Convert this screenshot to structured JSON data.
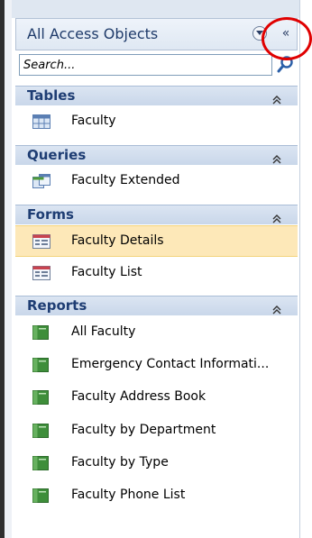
{
  "header": {
    "title": "All Access Objects",
    "shutter_label": "«"
  },
  "search": {
    "placeholder": "Search..."
  },
  "groups": {
    "tables": {
      "title": "Tables",
      "items": [
        {
          "label": "Faculty"
        }
      ]
    },
    "queries": {
      "title": "Queries",
      "items": [
        {
          "label": "Faculty Extended"
        }
      ]
    },
    "forms": {
      "title": "Forms",
      "items": [
        {
          "label": "Faculty Details"
        },
        {
          "label": "Faculty List"
        }
      ]
    },
    "reports": {
      "title": "Reports",
      "items": [
        {
          "label": "All Faculty"
        },
        {
          "label": "Emergency Contact Informati..."
        },
        {
          "label": "Faculty Address Book"
        },
        {
          "label": "Faculty by Department"
        },
        {
          "label": "Faculty by Type"
        },
        {
          "label": "Faculty Phone List"
        }
      ]
    }
  },
  "colors": {
    "selected_bg": "#fde8b8",
    "group_text": "#1e3d73",
    "highlight_ring": "#e00000"
  },
  "icons": {
    "table": "table-icon",
    "query": "query-icon",
    "form": "form-icon",
    "report": "report-icon",
    "search": "search-icon",
    "collapse": "collapse-chevrons-icon",
    "dropdown": "dropdown-arrow-icon"
  }
}
